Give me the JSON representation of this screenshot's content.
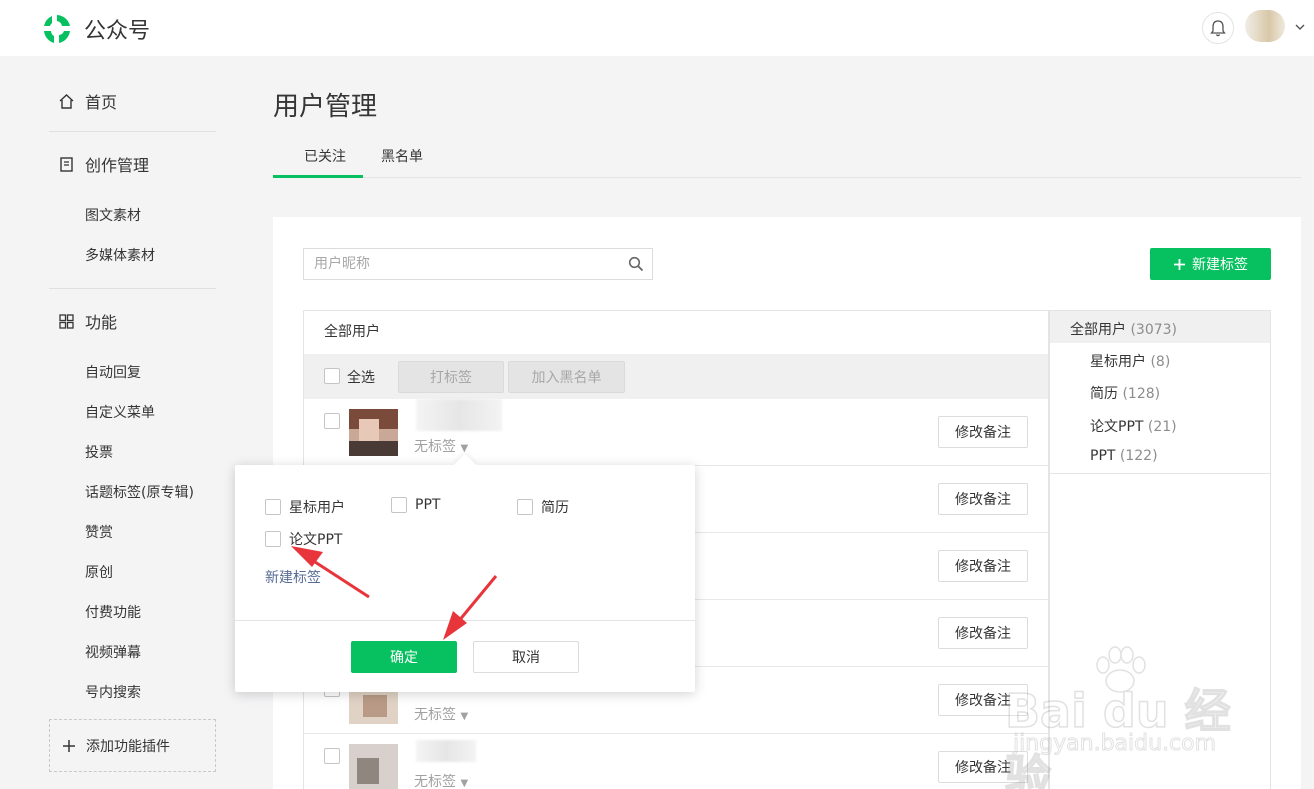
{
  "app": {
    "brand": "公众号"
  },
  "sidebar": {
    "home": "首页",
    "creation": {
      "label": "创作管理",
      "items": [
        "图文素材",
        "多媒体素材"
      ]
    },
    "features": {
      "label": "功能",
      "items": [
        "自动回复",
        "自定义菜单",
        "投票",
        "话题标签(原专辑)",
        "赞赏",
        "原创",
        "付费功能",
        "视频弹幕",
        "号内搜索"
      ]
    },
    "add_plugin": "添加功能插件"
  },
  "main": {
    "title": "用户管理",
    "tabs": [
      "已关注",
      "黑名单"
    ],
    "search": {
      "placeholder": "用户昵称"
    },
    "new_tag_button": "新建标签",
    "list": {
      "header": "全部用户",
      "select_all": "全选",
      "tag_button": "打标签",
      "blacklist_button": "加入黑名单",
      "rows": [
        {
          "tag": "无标签",
          "remark": "修改备注"
        },
        {
          "tag": "",
          "remark": "修改备注"
        },
        {
          "tag": "",
          "remark": "修改备注"
        },
        {
          "tag": "",
          "remark": "修改备注"
        },
        {
          "tag": "无标签",
          "remark": "修改备注"
        },
        {
          "tag": "无标签",
          "remark": "修改备注"
        }
      ]
    },
    "tag_panel": {
      "all": {
        "label": "全部用户",
        "count": "(3073)"
      },
      "items": [
        {
          "label": "星标用户",
          "count": "(8)"
        },
        {
          "label": "简历",
          "count": "(128)"
        },
        {
          "label": "论文PPT",
          "count": "(21)"
        },
        {
          "label": "PPT",
          "count": "(122)"
        }
      ]
    }
  },
  "popover": {
    "options": [
      "星标用户",
      "PPT",
      "简历",
      "论文PPT"
    ],
    "new_tag_link": "新建标签",
    "confirm": "确定",
    "cancel": "取消"
  },
  "watermark": {
    "text": "Bai du 经验",
    "url": "jingyan.baidu.com"
  },
  "colors": {
    "accent": "#07c160",
    "link": "#576b95",
    "annotation_arrow": "#e8353b"
  }
}
